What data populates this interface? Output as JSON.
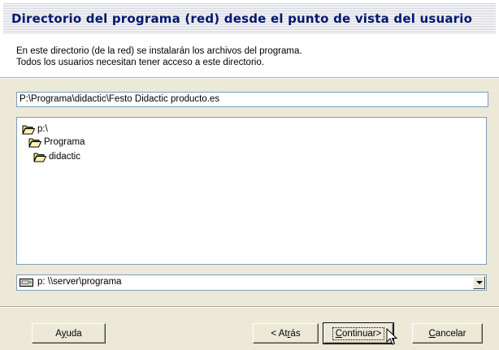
{
  "header": {
    "title": "Directorio del programa (red)  desde el punto de vista del usuario",
    "description_lines": [
      "En este directorio (de la red) se instalarán los archivos del programa.",
      "Todos los usuarios necesitan tener acceso a este directorio."
    ]
  },
  "path_input": {
    "value": "P:\\Programa\\didactic\\Festo Didactic producto.es"
  },
  "tree": {
    "items": [
      {
        "label": "p:\\",
        "icon": "open-folder-icon"
      },
      {
        "label": "Programa",
        "icon": "open-folder-icon"
      },
      {
        "label": "didactic",
        "icon": "open-folder-icon"
      }
    ]
  },
  "drive_select": {
    "selected": "p:  \\\\server\\programa",
    "icon": "network-drive-icon"
  },
  "buttons": {
    "help": {
      "pre": "A",
      "mnemonic": "y",
      "post": "uda"
    },
    "back": {
      "pre": "< At",
      "mnemonic": "r",
      "post": "ás"
    },
    "continue": {
      "pre": "",
      "mnemonic": "C",
      "post": "ontinuar>"
    },
    "cancel": {
      "pre": "",
      "mnemonic": "C",
      "post": "ancelar"
    }
  },
  "colors": {
    "title_text": "#00176e",
    "dialog_background": "#ece9d8",
    "field_border": "#7f9db9"
  }
}
